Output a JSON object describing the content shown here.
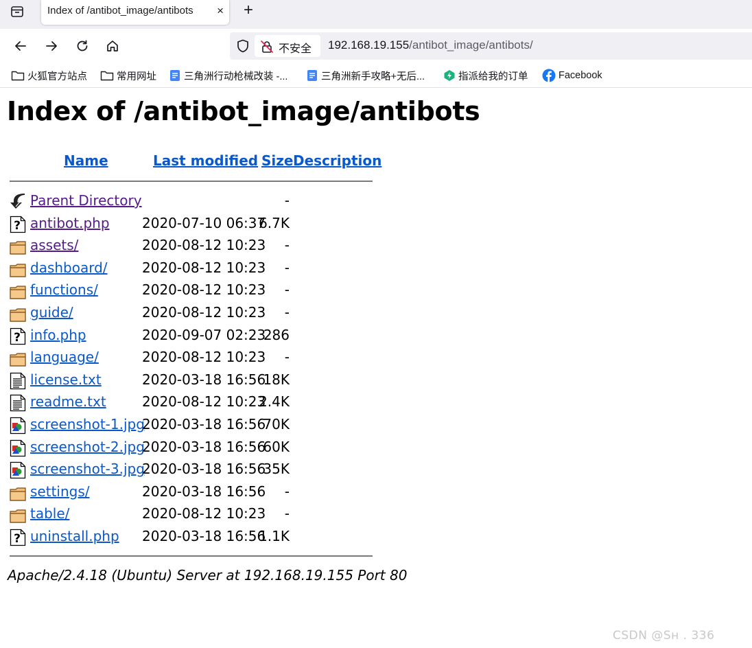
{
  "browser": {
    "tab_title": "Index of /antibot_image/antibots",
    "tab_close": "×",
    "new_tab": "+",
    "security_label": "不安全",
    "url_host": "192.168.19.155",
    "url_path": "/antibot_image/antibots/"
  },
  "bookmarks": [
    {
      "label": "火狐官方站点",
      "icon": "folder-icon"
    },
    {
      "label": "常用网址",
      "icon": "folder-icon"
    },
    {
      "label": "三角洲行动枪械改装 -...",
      "icon": "doc-icon"
    },
    {
      "label": "三角洲新手攻略+无后...",
      "icon": "doc-icon"
    },
    {
      "label": "指派给我的订单",
      "icon": "green-logo-icon"
    },
    {
      "label": "Facebook",
      "icon": "facebook-icon"
    }
  ],
  "page": {
    "title": "Index of /antibot_image/antibots",
    "columns": {
      "name": "Name",
      "last_modified": "Last modified",
      "size": "Size",
      "description": "Description"
    },
    "rows": [
      {
        "icon": "back",
        "name": "Parent Directory",
        "date": "",
        "size": "-",
        "visited": true
      },
      {
        "icon": "unknown",
        "name": "antibot.php",
        "date": "2020-07-10 06:37",
        "size": "6.7K",
        "visited": true
      },
      {
        "icon": "folder",
        "name": "assets/",
        "date": "2020-08-12 10:23",
        "size": "-",
        "visited": true
      },
      {
        "icon": "folder",
        "name": "dashboard/",
        "date": "2020-08-12 10:23",
        "size": "-",
        "visited": false
      },
      {
        "icon": "folder",
        "name": "functions/",
        "date": "2020-08-12 10:23",
        "size": "-",
        "visited": false
      },
      {
        "icon": "folder",
        "name": "guide/",
        "date": "2020-08-12 10:23",
        "size": "-",
        "visited": false
      },
      {
        "icon": "unknown",
        "name": "info.php",
        "date": "2020-09-07 02:23",
        "size": "286",
        "visited": false
      },
      {
        "icon": "folder",
        "name": "language/",
        "date": "2020-08-12 10:23",
        "size": "-",
        "visited": false
      },
      {
        "icon": "text",
        "name": "license.txt",
        "date": "2020-03-18 16:56",
        "size": "18K",
        "visited": false
      },
      {
        "icon": "text",
        "name": "readme.txt",
        "date": "2020-08-12 10:23",
        "size": "2.4K",
        "visited": false
      },
      {
        "icon": "image",
        "name": "screenshot-1.jpg",
        "date": "2020-03-18 16:56",
        "size": "70K",
        "visited": false
      },
      {
        "icon": "image",
        "name": "screenshot-2.jpg",
        "date": "2020-03-18 16:56",
        "size": "60K",
        "visited": false
      },
      {
        "icon": "image",
        "name": "screenshot-3.jpg",
        "date": "2020-03-18 16:56",
        "size": "35K",
        "visited": false
      },
      {
        "icon": "folder",
        "name": "settings/",
        "date": "2020-03-18 16:56",
        "size": "-",
        "visited": false
      },
      {
        "icon": "folder",
        "name": "table/",
        "date": "2020-08-12 10:23",
        "size": "-",
        "visited": false
      },
      {
        "icon": "unknown",
        "name": "uninstall.php",
        "date": "2020-03-18 16:56",
        "size": "1.1K",
        "visited": false
      }
    ],
    "server_signature": "Apache/2.4.18 (Ubuntu) Server at 192.168.19.155 Port 80"
  },
  "watermark": "CSDN @Sʜ     . 336",
  "colors": {
    "link": "#0a58ca",
    "visited": "#551a8b",
    "chrome_bg": "#f0f0f4"
  }
}
